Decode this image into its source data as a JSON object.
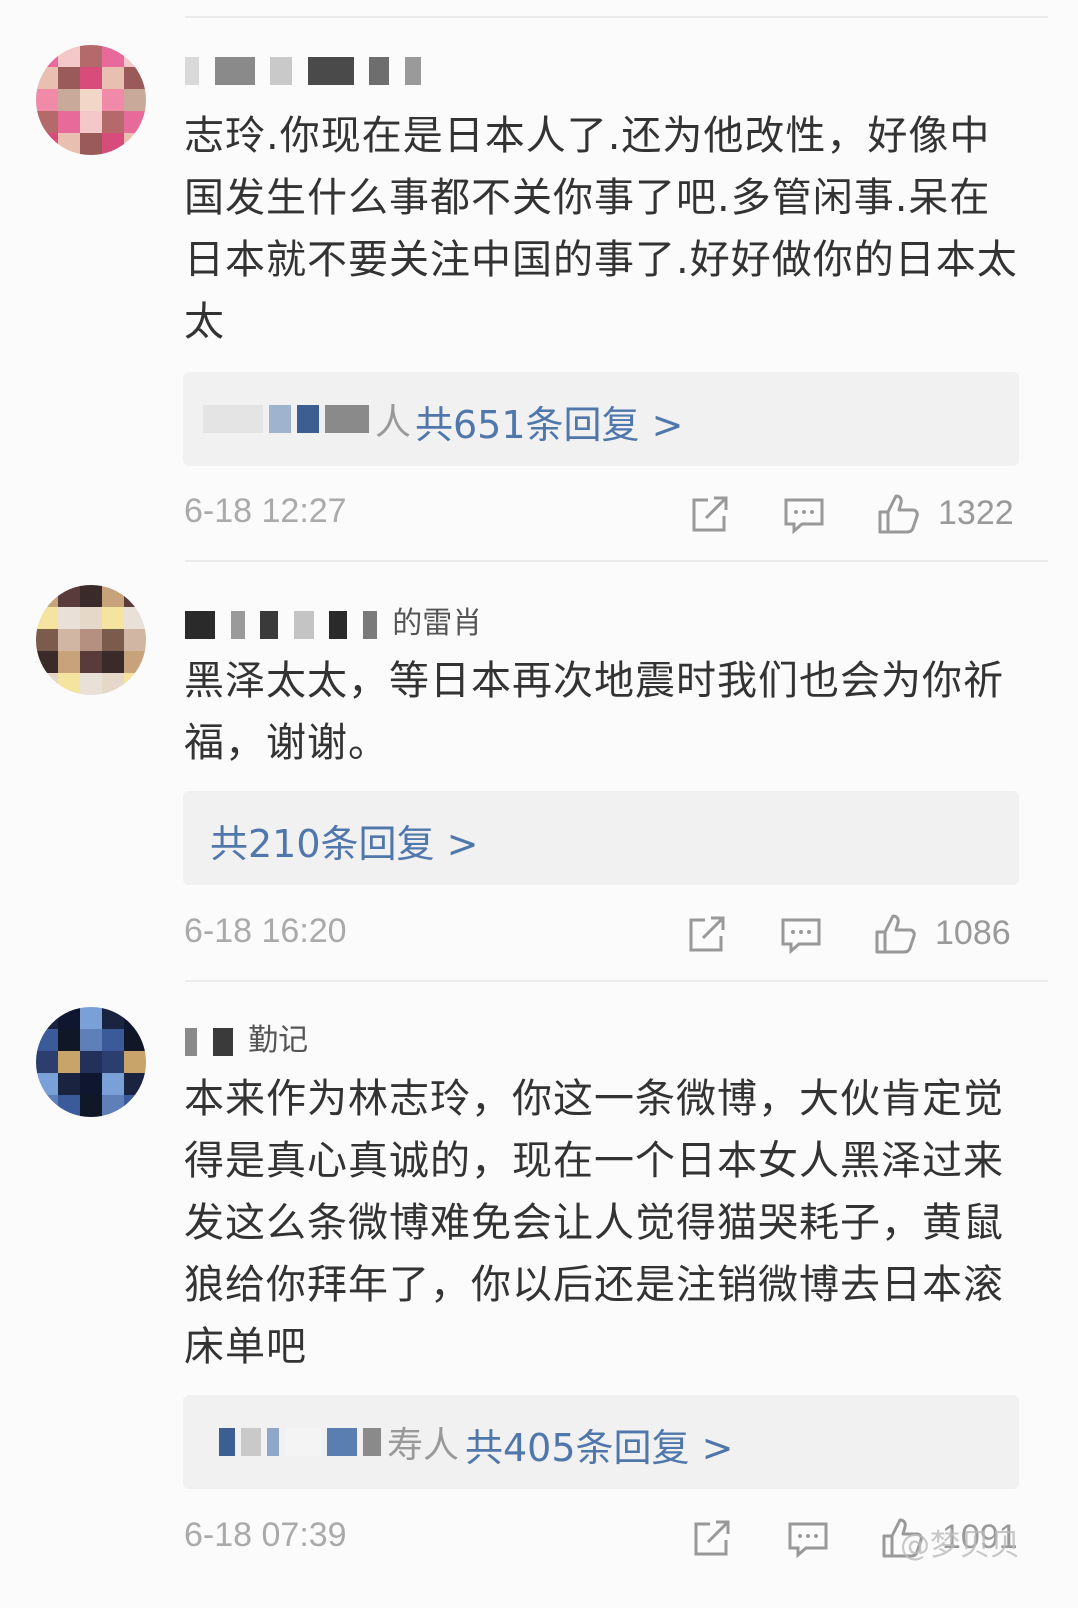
{
  "comments": [
    {
      "text": "志玲.你现在是日本人了.还为他改性，好像中国发生什么事都不关你事了吧.多管闲事.呆在日本就不要关注中国的事了.好好做你的日本太太",
      "reply_users": "人",
      "reply_link": "共651条回复 >",
      "timestamp": "6-18 12:27",
      "likes": "1322",
      "avatar_colors": [
        "#e86a9a",
        "#f08aa8",
        "#d84c7c",
        "#f4c7c9",
        "#c9a99a",
        "#e8bfb0",
        "#b46a6a",
        "#f2d6c8",
        "#9a5a5a"
      ]
    },
    {
      "name_suffix": "的雷肖",
      "text": "黑泽太太，等日本再次地震时我们也会为你祈福，谢谢。",
      "reply_link": "共210条回复 >",
      "timestamp": "6-18 16:20",
      "likes": "1086",
      "avatar_colors": [
        "#c8a27a",
        "#7b5b4b",
        "#e6d8c8",
        "#5a3b3b",
        "#d1b7a3",
        "#f5e3a0",
        "#3b2a2a",
        "#b58f7f",
        "#e9e0d8"
      ]
    },
    {
      "name_suffix": "勤记",
      "text": "本来作为林志玲，你这一条微博，大伙肯定觉得是真心真诚的，现在一个日本女人黑泽过来发这么条微博难免会让人觉得猫哭耗子，黄鼠狼给你拜年了，你以后还是注销微博去日本滚床单吧",
      "reply_users": "寿人",
      "reply_link": "共405条回复 >",
      "timestamp": "6-18 07:39",
      "likes": "1091",
      "avatar_colors": [
        "#1a2340",
        "#2c3e6e",
        "#5f7fb8",
        "#0e1630",
        "#c9a46a",
        "#3a5a9a",
        "#7aa0d8",
        "#22305a",
        "#101828"
      ]
    }
  ],
  "watermark": "@梦贝贝"
}
